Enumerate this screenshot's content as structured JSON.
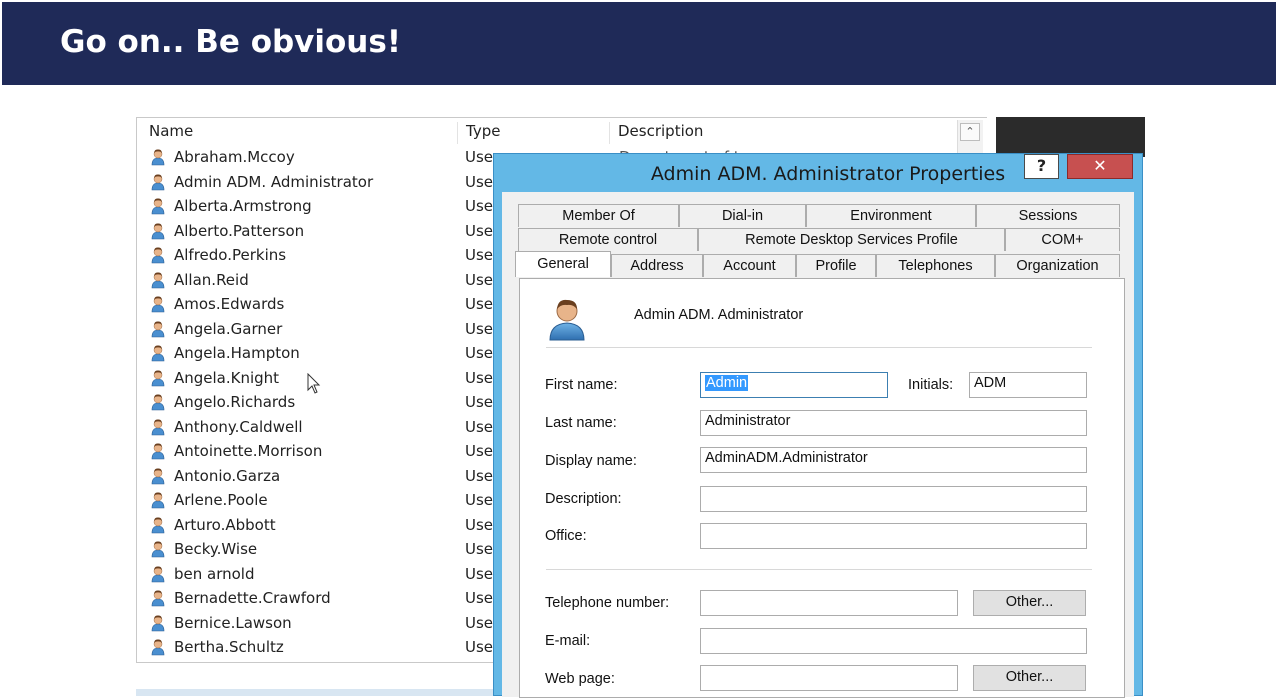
{
  "slide_title": "Go on..  Be obvious!",
  "list": {
    "columns": [
      "Name",
      "Type",
      "Description"
    ],
    "rows": [
      {
        "name": "Abraham.Mccoy",
        "type": "Use",
        "description": "Department of t..."
      },
      {
        "name": "Admin ADM. Administrator",
        "type": "Use",
        "description": ""
      },
      {
        "name": "Alberta.Armstrong",
        "type": "Use",
        "description": ""
      },
      {
        "name": "Alberto.Patterson",
        "type": "Use",
        "description": ""
      },
      {
        "name": "Alfredo.Perkins",
        "type": "Use",
        "description": ""
      },
      {
        "name": "Allan.Reid",
        "type": "Use",
        "description": ""
      },
      {
        "name": "Amos.Edwards",
        "type": "Use",
        "description": ""
      },
      {
        "name": "Angela.Garner",
        "type": "Use",
        "description": ""
      },
      {
        "name": "Angela.Hampton",
        "type": "Use",
        "description": ""
      },
      {
        "name": "Angela.Knight",
        "type": "Use",
        "description": ""
      },
      {
        "name": "Angelo.Richards",
        "type": "Use",
        "description": ""
      },
      {
        "name": "Anthony.Caldwell",
        "type": "Use",
        "description": ""
      },
      {
        "name": "Antoinette.Morrison",
        "type": "Use",
        "description": ""
      },
      {
        "name": "Antonio.Garza",
        "type": "Use",
        "description": ""
      },
      {
        "name": "Arlene.Poole",
        "type": "Use",
        "description": ""
      },
      {
        "name": "Arturo.Abbott",
        "type": "Use",
        "description": ""
      },
      {
        "name": "Becky.Wise",
        "type": "Use",
        "description": ""
      },
      {
        "name": "ben arnold",
        "type": "Use",
        "description": ""
      },
      {
        "name": "Bernadette.Crawford",
        "type": "Use",
        "description": ""
      },
      {
        "name": "Bernice.Lawson",
        "type": "Use",
        "description": ""
      },
      {
        "name": "Bertha.Schultz",
        "type": "Use",
        "description": ""
      }
    ],
    "scroll_up_glyph": "⌃"
  },
  "dialog": {
    "title": "Admin ADM. Administrator Properties",
    "help_label": "?",
    "close_label": "✕",
    "tabs_row1": [
      "Member Of",
      "Dial-in",
      "Environment",
      "Sessions"
    ],
    "tabs_row2": [
      "Remote control",
      "Remote Desktop Services Profile",
      "COM+"
    ],
    "tabs_row3": [
      "General",
      "Address",
      "Account",
      "Profile",
      "Telephones",
      "Organization"
    ],
    "active_tab": "General",
    "object_name": "Admin ADM. Administrator",
    "fields": {
      "first_name_label": "First name:",
      "first_name_value": "Admin",
      "initials_label": "Initials:",
      "initials_value": "ADM",
      "last_name_label": "Last name:",
      "last_name_value": "Administrator",
      "display_name_label": "Display name:",
      "display_name_value": "AdminADM.Administrator",
      "description_label": "Description:",
      "description_value": "",
      "office_label": "Office:",
      "office_value": "",
      "telephone_label": "Telephone number:",
      "telephone_value": "",
      "email_label": "E-mail:",
      "email_value": "",
      "webpage_label": "Web page:",
      "webpage_value": ""
    },
    "other_button_label": "Other...",
    "colors": {
      "title_bar": "#63b8e6",
      "close": "#c75050",
      "selection": "#3399ff"
    }
  }
}
